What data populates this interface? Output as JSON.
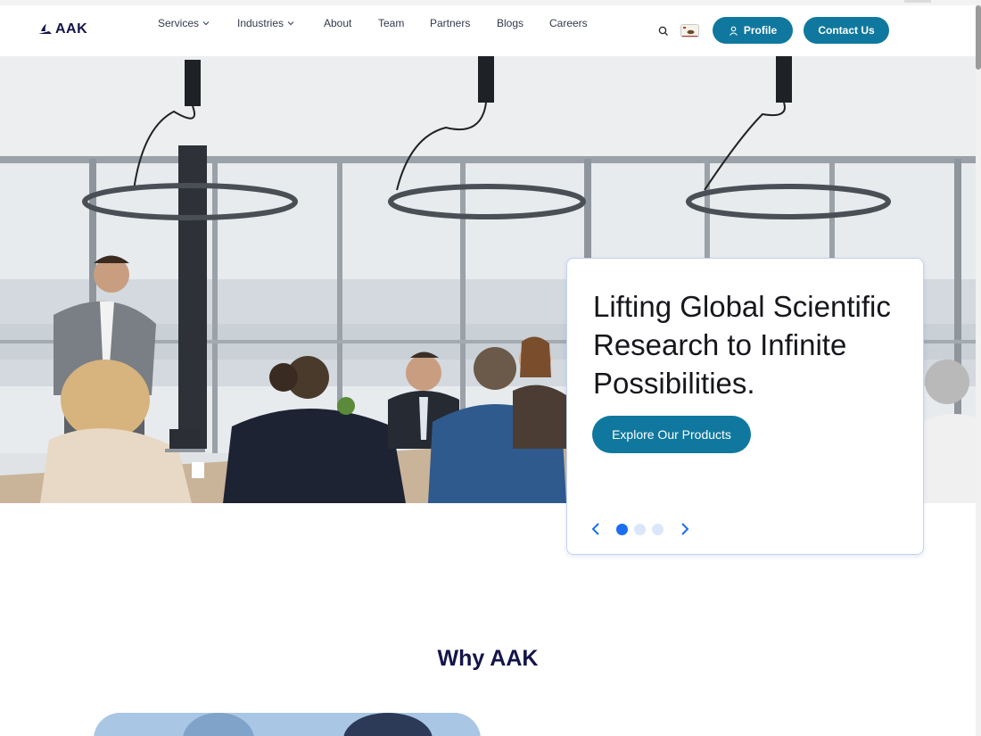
{
  "brand": {
    "name": "AAK",
    "color": "#13154a"
  },
  "nav": {
    "items": [
      {
        "label": "Services",
        "has_dropdown": true
      },
      {
        "label": "Industries",
        "has_dropdown": true
      },
      {
        "label": "About",
        "has_dropdown": false
      },
      {
        "label": "Team",
        "has_dropdown": false
      },
      {
        "label": "Partners",
        "has_dropdown": false
      },
      {
        "label": "Blogs",
        "has_dropdown": false
      },
      {
        "label": "Careers",
        "has_dropdown": false
      }
    ],
    "search_icon": "search-icon",
    "flag_icon": "california-flag-icon",
    "profile_label": "Profile",
    "contact_label": "Contact Us"
  },
  "hero": {
    "image_icon": "office-meeting-photo",
    "title": "Lifting Global Scientific Research to Infinite Possibilities.",
    "cta_label": "Explore Our Products",
    "carousel": {
      "total": 3,
      "active": 1
    }
  },
  "why": {
    "title": "Why AAK",
    "image_icon": "team-photo"
  },
  "colors": {
    "accent": "#10789e",
    "dot_active": "#1b6ef0",
    "dot_inactive": "#dce6fb",
    "heading": "#13154a"
  }
}
